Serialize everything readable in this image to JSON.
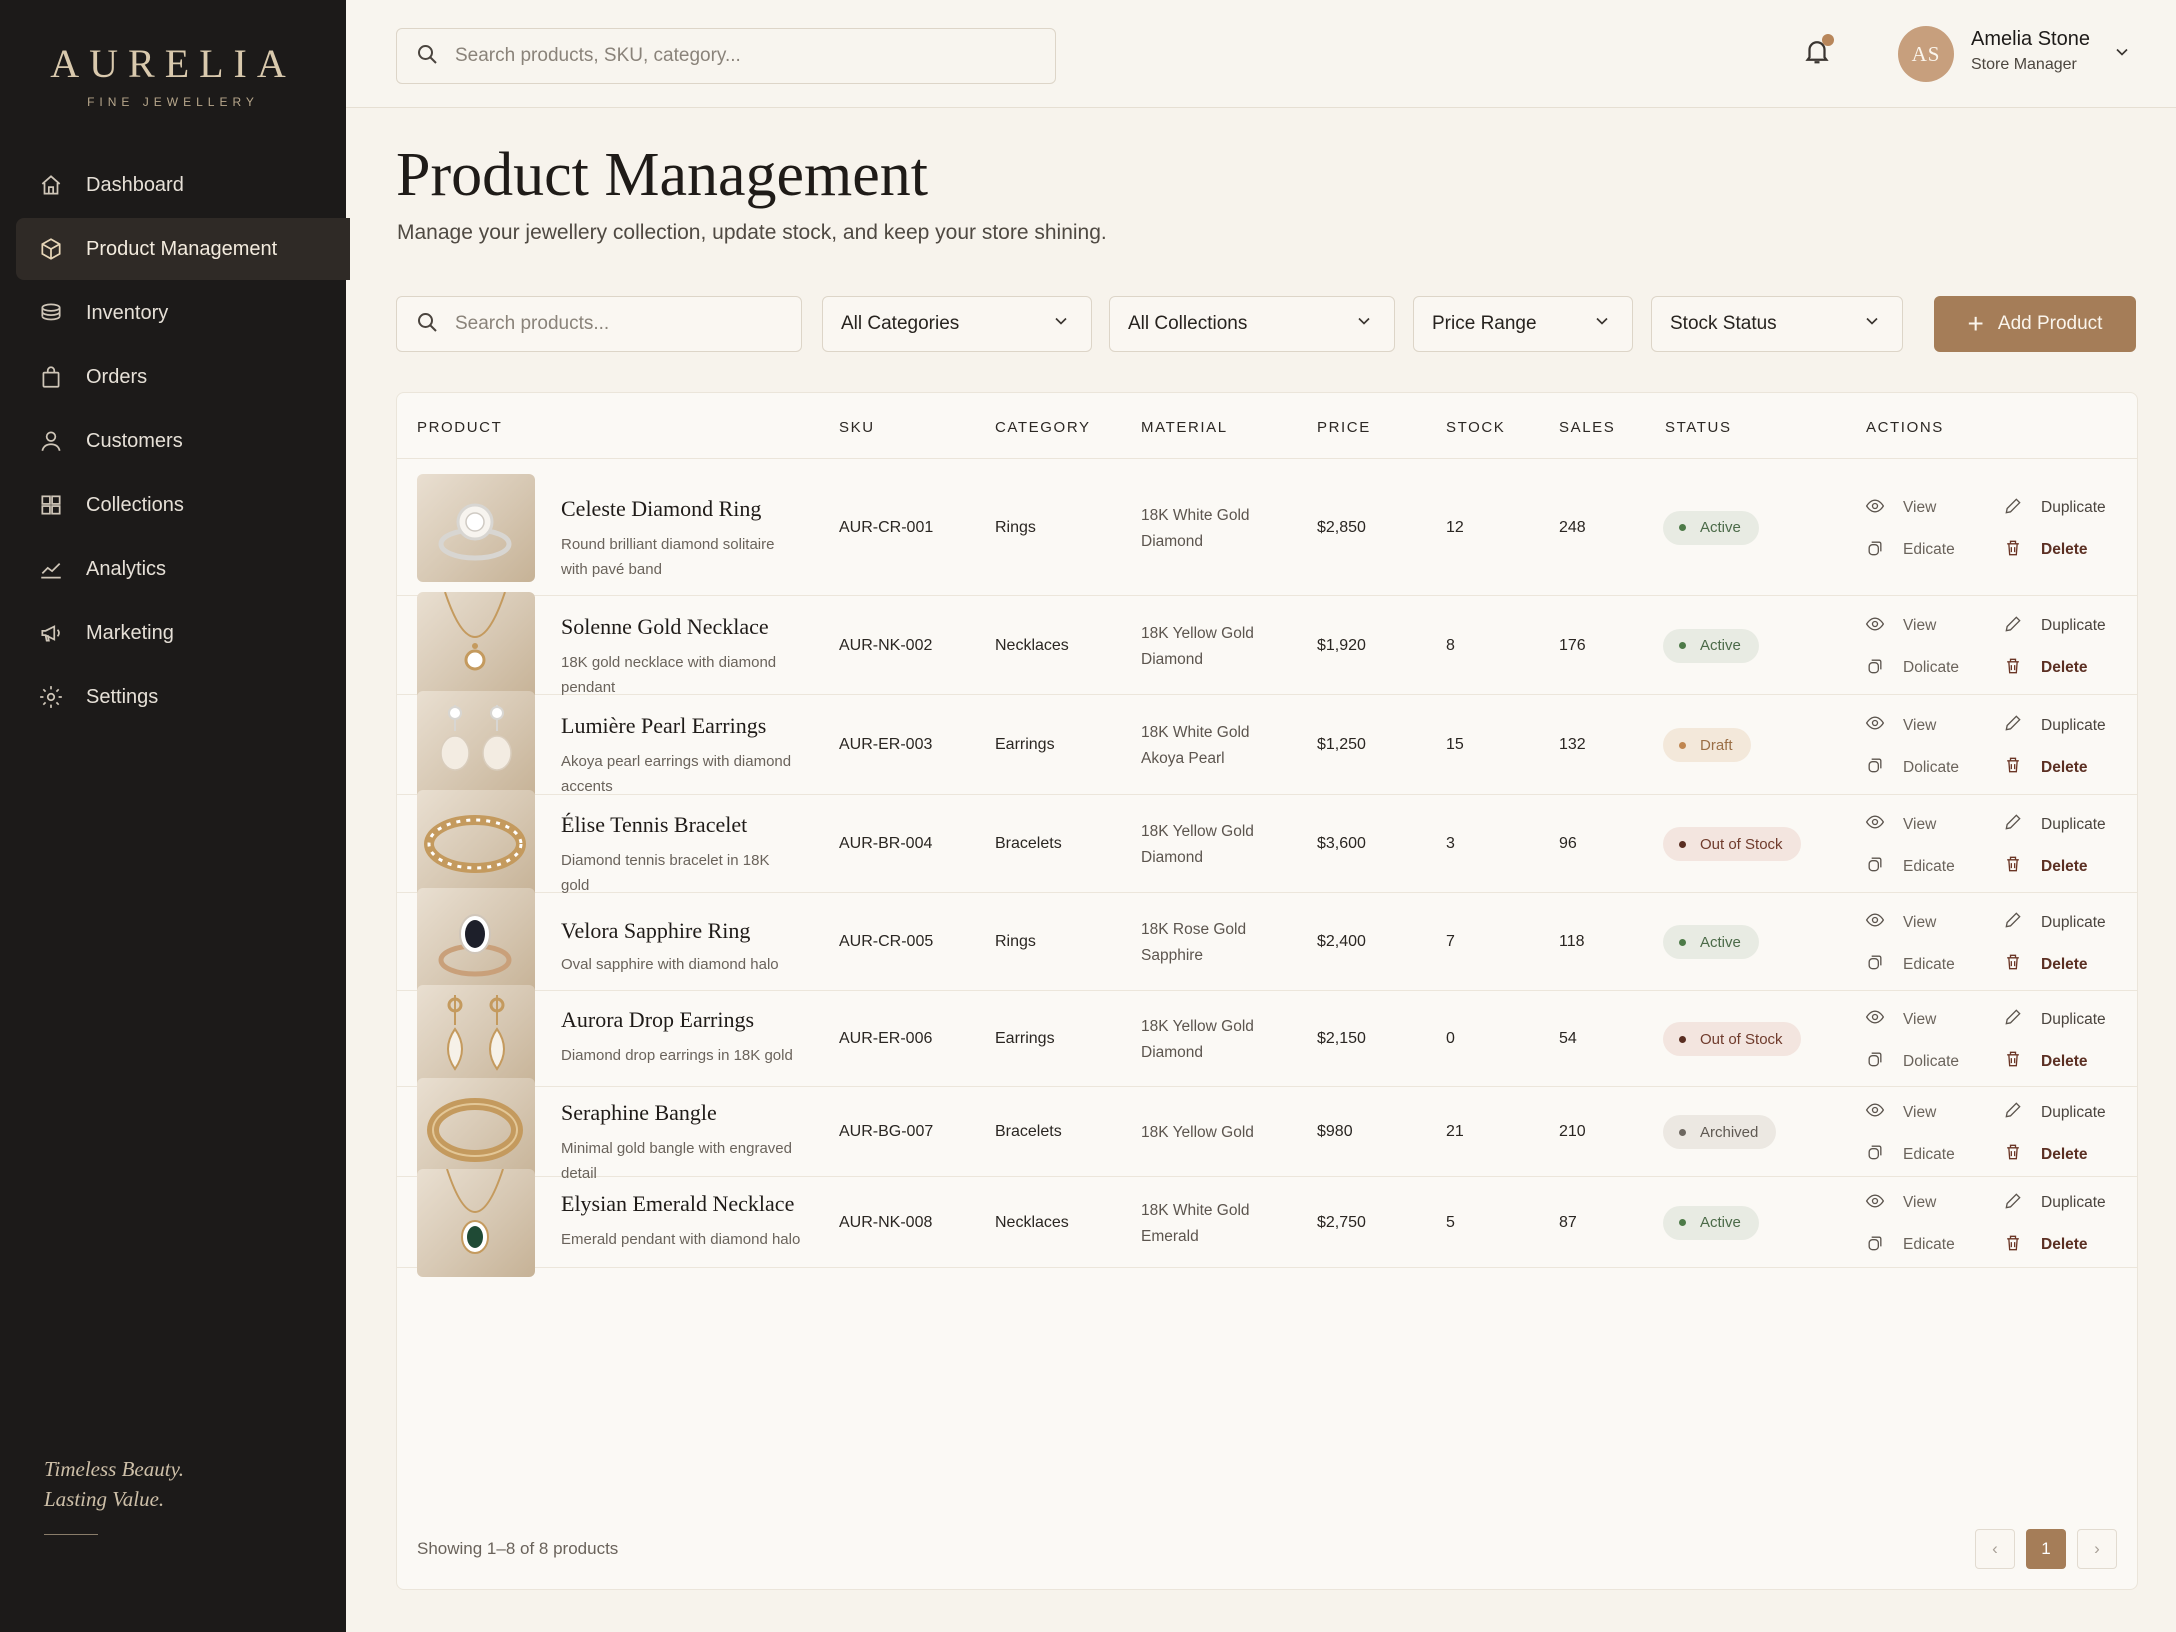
{
  "brand": {
    "name": "AURELIA",
    "subtitle": "FINE JEWELLERY"
  },
  "sidebar": {
    "items": [
      {
        "label": "Dashboard",
        "icon": "home-icon",
        "active": false
      },
      {
        "label": "Product Management",
        "icon": "box-icon",
        "active": true
      },
      {
        "label": "Inventory",
        "icon": "layers-icon",
        "active": false
      },
      {
        "label": "Orders",
        "icon": "bag-icon",
        "active": false
      },
      {
        "label": "Customers",
        "icon": "user-icon",
        "active": false
      },
      {
        "label": "Collections",
        "icon": "grid-icon",
        "active": false
      },
      {
        "label": "Analytics",
        "icon": "chart-icon",
        "active": false
      },
      {
        "label": "Marketing",
        "icon": "megaphone-icon",
        "active": false
      },
      {
        "label": "Settings",
        "icon": "gear-icon",
        "active": false
      }
    ],
    "tagline_line1": "Timeless Beauty.",
    "tagline_line2": "Lasting Value."
  },
  "topbar": {
    "search_placeholder": "Search products, SKU, category...",
    "user_initials": "AS",
    "user_name": "Amelia Stone",
    "user_role": "Store Manager"
  },
  "header": {
    "title": "Product Management",
    "subtitle": "Manage your jewellery collection, update stock, and keep your store shining."
  },
  "filters": {
    "search_placeholder": "Search products...",
    "categories": "All Categories",
    "collections": "All Collections",
    "price": "Price Range",
    "stock": "Stock Status",
    "add_label": "Add Product"
  },
  "table": {
    "headers": [
      "PRODUCT",
      "SKU",
      "CATEGORY",
      "MATERIAL",
      "PRICE",
      "STOCK",
      "SALES",
      "STATUS",
      "ACTIONS"
    ],
    "action_labels": {
      "view": "View",
      "duplicate": "Duplicate",
      "delete": "Delete"
    },
    "rows": [
      {
        "name": "Celeste Diamond Ring",
        "desc": "Round brilliant diamond solitaire with pavé band",
        "sku": "AUR-CR-001",
        "category": "Rings",
        "material": "18K White Gold Diamond",
        "price": "$2,850",
        "stock": "12",
        "sales": "248",
        "status": "Active",
        "status_type": "active",
        "edit": "Edicate",
        "thumb": "ring"
      },
      {
        "name": "Solenne Gold Necklace",
        "desc": "18K gold necklace with diamond pendant",
        "sku": "AUR-NK-002",
        "category": "Necklaces",
        "material": "18K Yellow Gold Diamond",
        "price": "$1,920",
        "stock": "8",
        "sales": "176",
        "status": "Active",
        "status_type": "active",
        "edit": "Dolicate",
        "thumb": "necklace"
      },
      {
        "name": "Lumière Pearl Earrings",
        "desc": "Akoya pearl earrings with diamond accents",
        "sku": "AUR-ER-003",
        "category": "Earrings",
        "material": "18K White Gold Akoya Pearl",
        "price": "$1,250",
        "stock": "15",
        "sales": "132",
        "status": "Draft",
        "status_type": "draft",
        "edit": "Dolicate",
        "thumb": "pearl"
      },
      {
        "name": "Élise Tennis Bracelet",
        "desc": "Diamond tennis bracelet in 18K gold",
        "sku": "AUR-BR-004",
        "category": "Bracelets",
        "material": "18K Yellow Gold Diamond",
        "price": "$3,600",
        "stock": "3",
        "sales": "96",
        "status": "Out of Stock",
        "status_type": "oos",
        "edit": "Edicate",
        "thumb": "bracelet"
      },
      {
        "name": "Velora Sapphire Ring",
        "desc": "Oval sapphire with diamond halo",
        "sku": "AUR-CR-005",
        "category": "Rings",
        "material": "18K Rose Gold Sapphire",
        "price": "$2,400",
        "stock": "7",
        "sales": "118",
        "status": "Active",
        "status_type": "active",
        "edit": "Edicate",
        "thumb": "sapphire"
      },
      {
        "name": "Aurora Drop Earrings",
        "desc": "Diamond drop earrings in 18K gold",
        "sku": "AUR-ER-006",
        "category": "Earrings",
        "material": "18K Yellow Gold Diamond",
        "price": "$2,150",
        "stock": "0",
        "sales": "54",
        "status": "Out of Stock",
        "status_type": "oos",
        "edit": "Dolicate",
        "thumb": "drop"
      },
      {
        "name": "Seraphine Bangle",
        "desc": "Minimal gold bangle with engraved detail",
        "sku": "AUR-BG-007",
        "category": "Bracelets",
        "material": "18K Yellow Gold",
        "price": "$980",
        "stock": "21",
        "sales": "210",
        "status": "Archived",
        "status_type": "archived",
        "edit": "Edicate",
        "thumb": "bangle"
      },
      {
        "name": "Elysian Emerald Necklace",
        "desc": "Emerald pendant with diamond halo",
        "sku": "AUR-NK-008",
        "category": "Necklaces",
        "material": "18K White Gold Emerald",
        "price": "$2,750",
        "stock": "5",
        "sales": "87",
        "status": "Active",
        "status_type": "active",
        "edit": "Edicate",
        "thumb": "emerald"
      }
    ]
  },
  "footer": {
    "showing": "Showing 1–8 of 8 products",
    "prev": "‹",
    "page": "1",
    "next": "›"
  }
}
